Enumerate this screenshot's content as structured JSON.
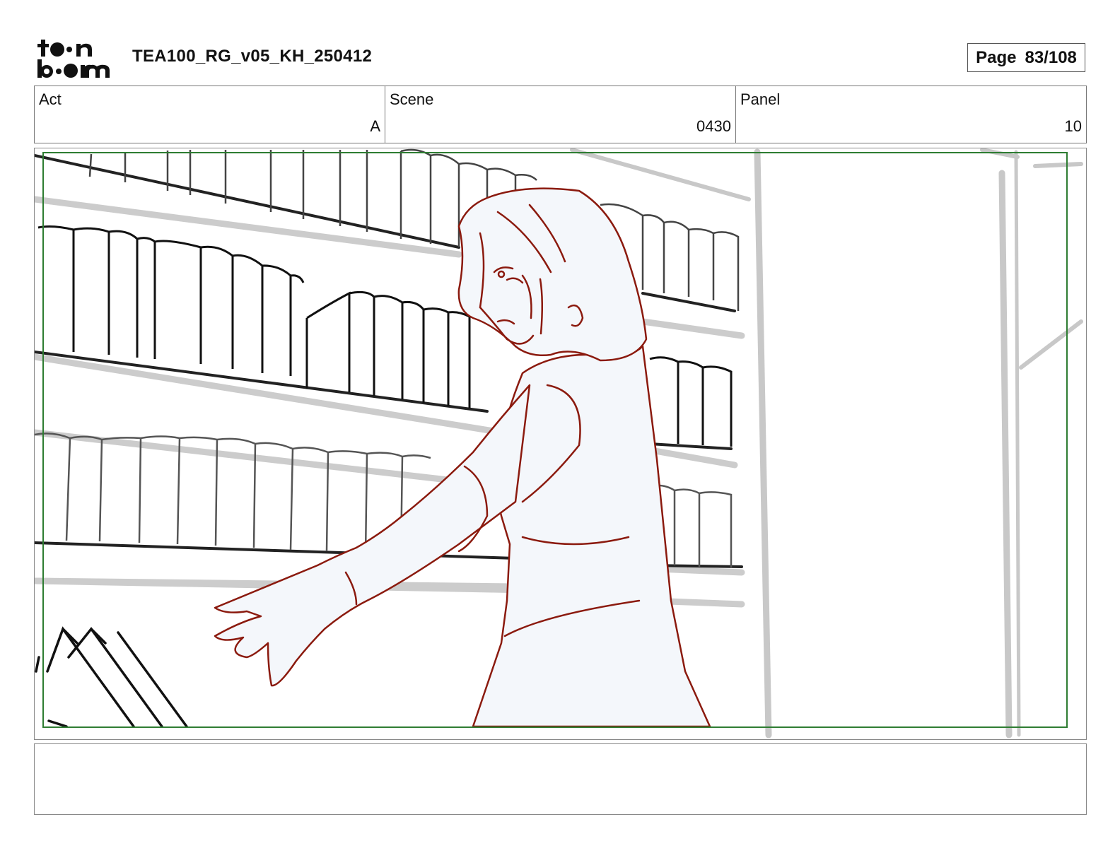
{
  "header": {
    "logo_text": "toon boom",
    "title": "TEA100_RG_v05_KH_250412",
    "page_label": "Page",
    "page_number": "83/108"
  },
  "fields": [
    {
      "label": "Act",
      "value": "A"
    },
    {
      "label": "Scene",
      "value": "0430"
    },
    {
      "label": "Panel",
      "value": "10"
    }
  ],
  "panel": {
    "safe_frame_color": "#2e7d32",
    "character_line_color": "#8b1a0e",
    "character_fill_color": "#f4f7fb",
    "shelf_line_color": "#222222",
    "pillar_color": "#c8c8c8"
  },
  "notes": {
    "text": ""
  }
}
